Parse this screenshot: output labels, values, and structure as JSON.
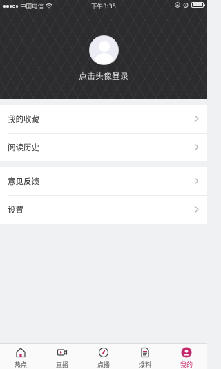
{
  "status_bar": {
    "carrier": "中国电信",
    "time": "下午3:35",
    "battery_level": 1.0
  },
  "profile": {
    "login_prompt": "点击头像登录"
  },
  "menu_group_1": [
    {
      "label": "我的收藏"
    },
    {
      "label": "阅读历史"
    }
  ],
  "menu_group_2": [
    {
      "label": "意见反馈"
    },
    {
      "label": "设置"
    }
  ],
  "tabbar": {
    "active_index": 4,
    "active_color": "#c4286a",
    "items": [
      {
        "label": "热点",
        "icon": "home-icon"
      },
      {
        "label": "直播",
        "icon": "video-camera-icon"
      },
      {
        "label": "点播",
        "icon": "compass-icon"
      },
      {
        "label": "爆料",
        "icon": "document-icon"
      },
      {
        "label": "我的",
        "icon": "user-icon"
      }
    ]
  }
}
